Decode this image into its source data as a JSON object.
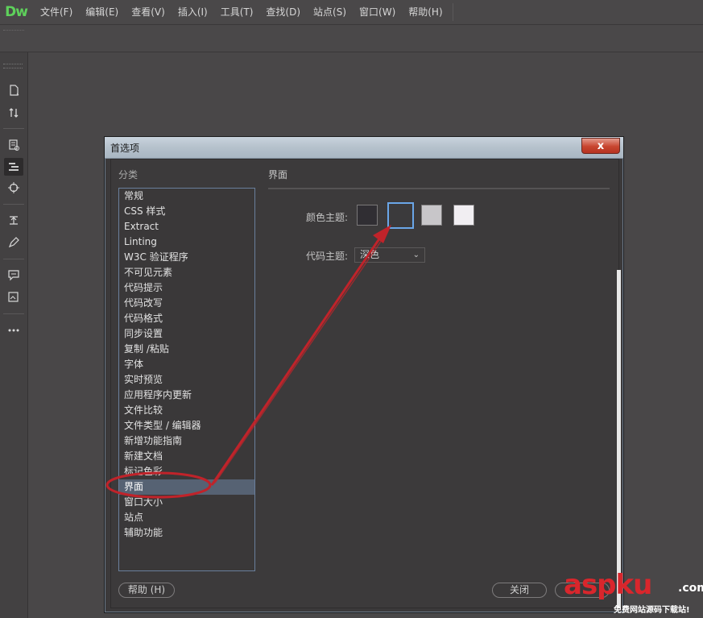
{
  "app": {
    "logo": "Dw"
  },
  "menu": [
    "文件(F)",
    "编辑(E)",
    "查看(V)",
    "插入(I)",
    "工具(T)",
    "查找(D)",
    "站点(S)",
    "窗口(W)",
    "帮助(H)"
  ],
  "tools": [
    {
      "icon": "new-document-icon"
    },
    {
      "icon": "sort-arrows-icon"
    },
    {
      "icon": "inspect-document-icon"
    },
    {
      "icon": "code-format-icon"
    },
    {
      "icon": "target-icon"
    },
    {
      "icon": "expand-icon"
    },
    {
      "icon": "pen-icon"
    },
    {
      "icon": "comment-icon"
    },
    {
      "icon": "image-info-icon"
    },
    {
      "icon": "more-icon"
    }
  ],
  "dialog": {
    "title": "首选项",
    "close_label": "x",
    "category_label": "分类",
    "categories": [
      "常规",
      "CSS 样式",
      "Extract",
      "Linting",
      "W3C 验证程序",
      "不可见元素",
      "代码提示",
      "代码改写",
      "代码格式",
      "同步设置",
      "复制 /粘贴",
      "字体",
      "实时预览",
      "应用程序内更新",
      "文件比较",
      "文件类型 / 编辑器",
      "新增功能指南",
      "新建文档",
      "标记色彩",
      "界面",
      "窗口大小",
      "站点",
      "辅助功能"
    ],
    "selected_category": "界面",
    "panel_title": "界面",
    "color_theme_label": "颜色主题:",
    "color_themes": [
      "#302e33",
      "#3b3a3c",
      "#c8c6c9",
      "#f1eef2"
    ],
    "selected_color_theme_index": 1,
    "code_theme_label": "代码主题:",
    "code_theme_value": "深色",
    "help_button": "帮助 (H)",
    "close_button": "关闭"
  },
  "watermark": {
    "brand": "aspku",
    "tld": ".com",
    "slogan": "免费网站源码下载站!"
  },
  "colors": {
    "annotation": "#c0232a",
    "accent": "#6aa6e8",
    "logo": "#5ed15b"
  }
}
